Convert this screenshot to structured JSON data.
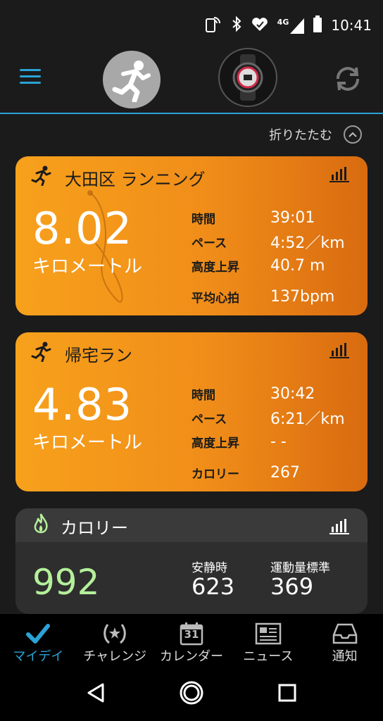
{
  "status_bar": {
    "network": "4G",
    "time": "10:41"
  },
  "header": {
    "collapse_label": "折りたたむ"
  },
  "cards": [
    {
      "title": "大田区 ランニング",
      "distance": "8.02",
      "unit": "キロメートル",
      "stats": [
        {
          "label": "時間",
          "value": "39:01"
        },
        {
          "label": "ペース",
          "value": "4:52／km"
        },
        {
          "label": "高度上昇",
          "value": "40.7 m"
        },
        {
          "label": "平均心拍",
          "value": "137bpm"
        }
      ]
    },
    {
      "title": "帰宅ラン",
      "distance": "4.83",
      "unit": "キロメートル",
      "stats": [
        {
          "label": "時間",
          "value": "30:42"
        },
        {
          "label": "ペース",
          "value": "6:21／km"
        },
        {
          "label": "高度上昇",
          "value": "- -"
        },
        {
          "label": "カロリー",
          "value": "267"
        }
      ]
    }
  ],
  "calories": {
    "title": "カロリー",
    "total": "992",
    "resting_label": "安静時",
    "resting_value": "623",
    "active_label": "運動量標準",
    "active_value": "369"
  },
  "tabs": [
    {
      "label": "マイデイ",
      "icon": "check-icon"
    },
    {
      "label": "チャレンジ",
      "icon": "laurel-icon"
    },
    {
      "label": "カレンダー",
      "icon": "calendar-icon",
      "calendar_day": "31"
    },
    {
      "label": "ニュース",
      "icon": "newspaper-icon"
    },
    {
      "label": "通知",
      "icon": "inbox-icon"
    }
  ],
  "colors": {
    "accent": "#2aa3d6",
    "run_card": "#f29218",
    "calorie_green": "#b5f09a"
  }
}
